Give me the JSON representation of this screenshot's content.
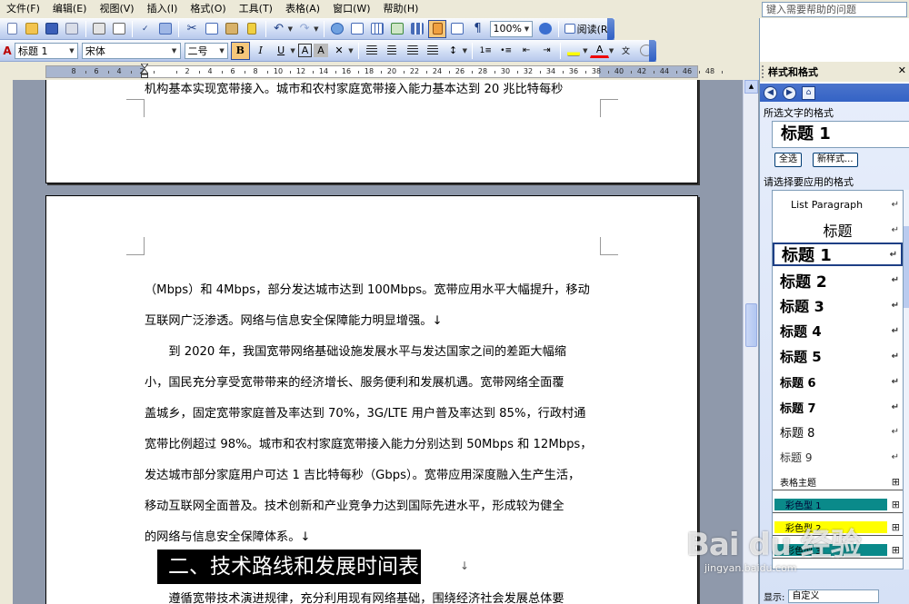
{
  "menu": [
    "文件(F)",
    "编辑(E)",
    "视图(V)",
    "插入(I)",
    "格式(O)",
    "工具(T)",
    "表格(A)",
    "窗口(W)",
    "帮助(H)"
  ],
  "help_search_placeholder": "键入需要帮助的问题",
  "toolbar1": {
    "zoom": "100%",
    "read_label": "阅读(R)"
  },
  "toolbar2": {
    "style": "标题 1",
    "font": "宋体",
    "size": "二号"
  },
  "ruler_numbers": [
    "8",
    "6",
    "4",
    "2",
    "",
    "2",
    "4",
    "6",
    "8",
    "10",
    "12",
    "14",
    "16",
    "18",
    "20",
    "22",
    "24",
    "26",
    "28",
    "30",
    "32",
    "34",
    "36",
    "38",
    "40",
    "42",
    "44",
    "46",
    "48"
  ],
  "document": {
    "page1_lines": [
      "机构基本实现宽带接入。城市和农村家庭宽带接入能力基本达到 20 兆比特每秒"
    ],
    "page2_lines": [
      "（Mbps）和 4Mbps，部分发达城市达到 100Mbps。宽带应用水平大幅提升，移动",
      "互联网广泛渗透。网络与信息安全保障能力明显增强。↓",
      "　　到 2020 年，我国宽带网络基础设施发展水平与发达国家之间的差距大幅缩",
      "小，国民充分享受宽带带来的经济增长、服务便利和发展机遇。宽带网络全面覆",
      "盖城乡，固定宽带家庭普及率达到 70%，3G/LTE 用户普及率达到 85%，行政村通",
      "宽带比例超过 98%。城市和农村家庭宽带接入能力分别达到 50Mbps 和 12Mbps，",
      "发达城市部分家庭用户可达 1 吉比特每秒（Gbps）。宽带应用深度融入生产生活，",
      "移动互联网全面普及。技术创新和产业竞争力达到国际先进水平，形成较为健全",
      "的网络与信息安全保障体系。↓"
    ],
    "heading": "二、技术路线和发展时间表",
    "heading_mark": "↓",
    "last_line": "　　遵循宽带技术演进规律，充分利用现有网络基础，围绕经济社会发展总体要"
  },
  "taskpane": {
    "title": "样式和格式",
    "selected_text_label": "所选文字的格式",
    "selected_format": "标题 1",
    "select_all_button": "全选",
    "new_style_button": "新样式...",
    "apply_label": "请选择要应用的格式",
    "styles": [
      {
        "name": "List Paragraph",
        "kind": "para"
      },
      {
        "name": "标题",
        "kind": "para"
      },
      {
        "name": "标题 1",
        "kind": "para",
        "selected": true
      },
      {
        "name": "标题 2",
        "kind": "para"
      },
      {
        "name": "标题 3",
        "kind": "para"
      },
      {
        "name": "标题 4",
        "kind": "para"
      },
      {
        "name": "标题 5",
        "kind": "para"
      },
      {
        "name": "标题 6",
        "kind": "para"
      },
      {
        "name": "标题 7",
        "kind": "para"
      },
      {
        "name": "标题 8",
        "kind": "para"
      },
      {
        "name": "标题 9",
        "kind": "para"
      },
      {
        "name": "表格主题",
        "kind": "table"
      },
      {
        "name": "彩色型 1",
        "kind": "table"
      },
      {
        "name": "彩色型 2",
        "kind": "table"
      },
      {
        "name": "彩色型 3",
        "kind": "table"
      }
    ],
    "show_label": "显示:",
    "show_value": "自定义"
  },
  "watermark": {
    "logo": "Bai du 经验",
    "url": "jingyan.baidu.com"
  },
  "colors": {
    "table_teal": "#0a8a8a",
    "table_yellow": "#ffff00",
    "selected_border": "#1e3f85",
    "doc_bg": "#8f99ab"
  }
}
